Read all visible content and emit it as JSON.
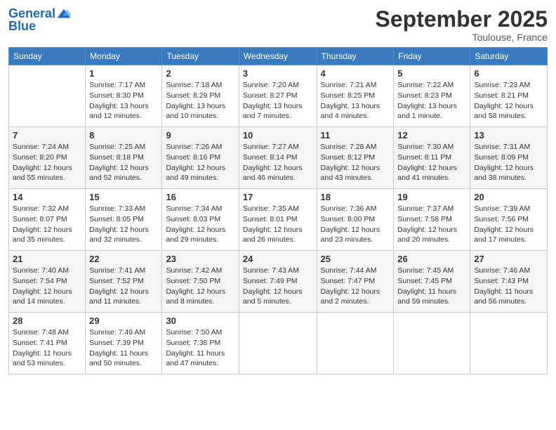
{
  "logo": {
    "line1": "General",
    "line2": "Blue"
  },
  "title": "September 2025",
  "location": "Toulouse, France",
  "days_of_week": [
    "Sunday",
    "Monday",
    "Tuesday",
    "Wednesday",
    "Thursday",
    "Friday",
    "Saturday"
  ],
  "weeks": [
    [
      {
        "day": "",
        "info": ""
      },
      {
        "day": "1",
        "info": "Sunrise: 7:17 AM\nSunset: 8:30 PM\nDaylight: 13 hours\nand 12 minutes."
      },
      {
        "day": "2",
        "info": "Sunrise: 7:18 AM\nSunset: 8:29 PM\nDaylight: 13 hours\nand 10 minutes."
      },
      {
        "day": "3",
        "info": "Sunrise: 7:20 AM\nSunset: 8:27 PM\nDaylight: 13 hours\nand 7 minutes."
      },
      {
        "day": "4",
        "info": "Sunrise: 7:21 AM\nSunset: 8:25 PM\nDaylight: 13 hours\nand 4 minutes."
      },
      {
        "day": "5",
        "info": "Sunrise: 7:22 AM\nSunset: 8:23 PM\nDaylight: 13 hours\nand 1 minute."
      },
      {
        "day": "6",
        "info": "Sunrise: 7:23 AM\nSunset: 8:21 PM\nDaylight: 12 hours\nand 58 minutes."
      }
    ],
    [
      {
        "day": "7",
        "info": "Sunrise: 7:24 AM\nSunset: 8:20 PM\nDaylight: 12 hours\nand 55 minutes."
      },
      {
        "day": "8",
        "info": "Sunrise: 7:25 AM\nSunset: 8:18 PM\nDaylight: 12 hours\nand 52 minutes."
      },
      {
        "day": "9",
        "info": "Sunrise: 7:26 AM\nSunset: 8:16 PM\nDaylight: 12 hours\nand 49 minutes."
      },
      {
        "day": "10",
        "info": "Sunrise: 7:27 AM\nSunset: 8:14 PM\nDaylight: 12 hours\nand 46 minutes."
      },
      {
        "day": "11",
        "info": "Sunrise: 7:28 AM\nSunset: 8:12 PM\nDaylight: 12 hours\nand 43 minutes."
      },
      {
        "day": "12",
        "info": "Sunrise: 7:30 AM\nSunset: 8:11 PM\nDaylight: 12 hours\nand 41 minutes."
      },
      {
        "day": "13",
        "info": "Sunrise: 7:31 AM\nSunset: 8:09 PM\nDaylight: 12 hours\nand 38 minutes."
      }
    ],
    [
      {
        "day": "14",
        "info": "Sunrise: 7:32 AM\nSunset: 8:07 PM\nDaylight: 12 hours\nand 35 minutes."
      },
      {
        "day": "15",
        "info": "Sunrise: 7:33 AM\nSunset: 8:05 PM\nDaylight: 12 hours\nand 32 minutes."
      },
      {
        "day": "16",
        "info": "Sunrise: 7:34 AM\nSunset: 8:03 PM\nDaylight: 12 hours\nand 29 minutes."
      },
      {
        "day": "17",
        "info": "Sunrise: 7:35 AM\nSunset: 8:01 PM\nDaylight: 12 hours\nand 26 minutes."
      },
      {
        "day": "18",
        "info": "Sunrise: 7:36 AM\nSunset: 8:00 PM\nDaylight: 12 hours\nand 23 minutes."
      },
      {
        "day": "19",
        "info": "Sunrise: 7:37 AM\nSunset: 7:58 PM\nDaylight: 12 hours\nand 20 minutes."
      },
      {
        "day": "20",
        "info": "Sunrise: 7:39 AM\nSunset: 7:56 PM\nDaylight: 12 hours\nand 17 minutes."
      }
    ],
    [
      {
        "day": "21",
        "info": "Sunrise: 7:40 AM\nSunset: 7:54 PM\nDaylight: 12 hours\nand 14 minutes."
      },
      {
        "day": "22",
        "info": "Sunrise: 7:41 AM\nSunset: 7:52 PM\nDaylight: 12 hours\nand 11 minutes."
      },
      {
        "day": "23",
        "info": "Sunrise: 7:42 AM\nSunset: 7:50 PM\nDaylight: 12 hours\nand 8 minutes."
      },
      {
        "day": "24",
        "info": "Sunrise: 7:43 AM\nSunset: 7:49 PM\nDaylight: 12 hours\nand 5 minutes."
      },
      {
        "day": "25",
        "info": "Sunrise: 7:44 AM\nSunset: 7:47 PM\nDaylight: 12 hours\nand 2 minutes."
      },
      {
        "day": "26",
        "info": "Sunrise: 7:45 AM\nSunset: 7:45 PM\nDaylight: 11 hours\nand 59 minutes."
      },
      {
        "day": "27",
        "info": "Sunrise: 7:46 AM\nSunset: 7:43 PM\nDaylight: 11 hours\nand 56 minutes."
      }
    ],
    [
      {
        "day": "28",
        "info": "Sunrise: 7:48 AM\nSunset: 7:41 PM\nDaylight: 11 hours\nand 53 minutes."
      },
      {
        "day": "29",
        "info": "Sunrise: 7:49 AM\nSunset: 7:39 PM\nDaylight: 11 hours\nand 50 minutes."
      },
      {
        "day": "30",
        "info": "Sunrise: 7:50 AM\nSunset: 7:38 PM\nDaylight: 11 hours\nand 47 minutes."
      },
      {
        "day": "",
        "info": ""
      },
      {
        "day": "",
        "info": ""
      },
      {
        "day": "",
        "info": ""
      },
      {
        "day": "",
        "info": ""
      }
    ]
  ]
}
